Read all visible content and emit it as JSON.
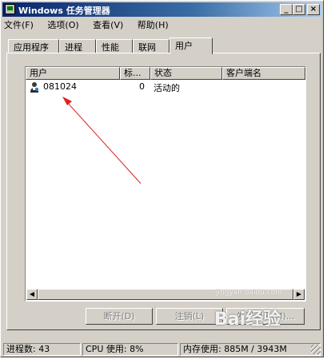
{
  "window": {
    "title": "Windows 任务管理器",
    "controls": {
      "minimize": "_",
      "maximize": "□",
      "close": "×"
    }
  },
  "menu": [
    "文件(F)",
    "选项(O)",
    "查看(V)",
    "帮助(H)"
  ],
  "tabs": [
    {
      "label": "应用程序",
      "active": false
    },
    {
      "label": "进程",
      "active": false
    },
    {
      "label": "性能",
      "active": false
    },
    {
      "label": "联网",
      "active": false
    },
    {
      "label": "用户",
      "active": true
    }
  ],
  "list": {
    "columns": [
      "用户",
      "标...",
      "状态",
      "客户端名"
    ],
    "rows": [
      {
        "user": "081024",
        "id": "0",
        "status": "活动的",
        "client": "",
        "icon": "user-icon"
      }
    ]
  },
  "buttons": {
    "disconnect": "断开(D)",
    "logoff": "注销(L)",
    "send_message": "发送消息(M)..."
  },
  "status": {
    "processes": "进程数: 43",
    "cpu": "CPU 使用: 8%",
    "memory": "内存使用: 885M / 3943M"
  },
  "watermark": {
    "text": "Bai经验",
    "url": "jingyan.baidu.com"
  },
  "annotation": {
    "arrow_color": "#e02020"
  }
}
